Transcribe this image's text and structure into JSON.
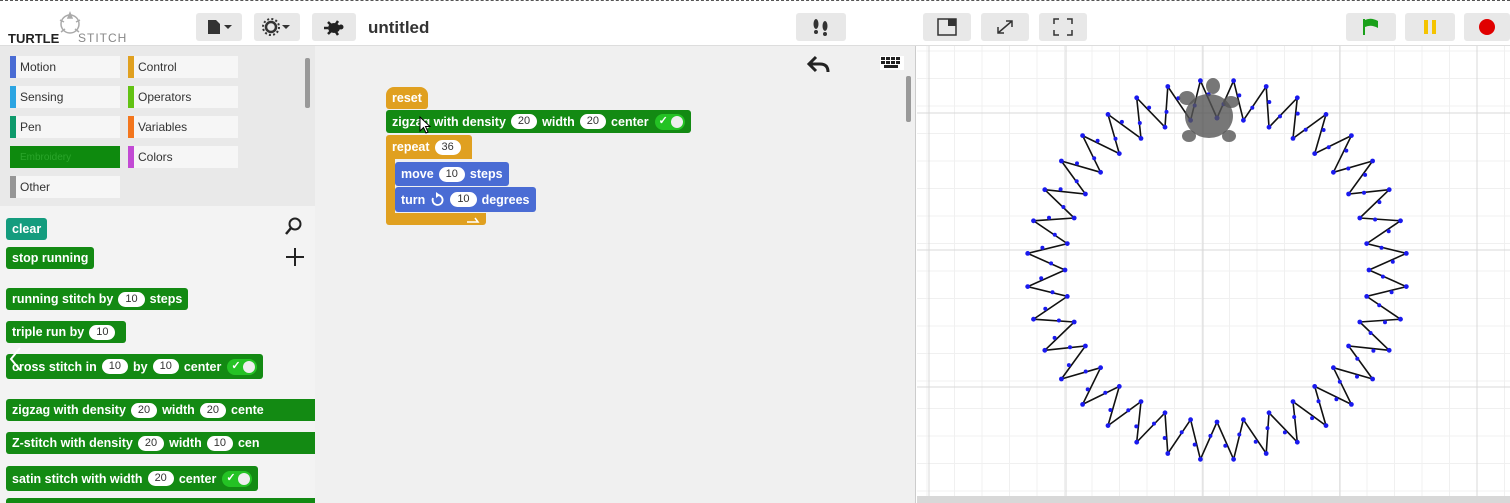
{
  "app": {
    "logo_left": "TURTLE",
    "logo_right": "STITCH",
    "project_name": "untitled"
  },
  "categories": [
    {
      "label": "Motion",
      "color": "#4a6cd4"
    },
    {
      "label": "Control",
      "color": "#e0a020"
    },
    {
      "label": "Sensing",
      "color": "#2ca5e2"
    },
    {
      "label": "Operators",
      "color": "#62c213"
    },
    {
      "label": "Pen",
      "color": "#0e9a6c"
    },
    {
      "label": "Variables",
      "color": "#f3761d"
    },
    {
      "label": "Embroidery",
      "color": "#0e8a0e"
    },
    {
      "label": "Colors",
      "color": "#c24ad4"
    },
    {
      "label": "Other",
      "color": "#969696"
    }
  ],
  "palette_blocks": {
    "clear": "clear",
    "stop": "stop running",
    "running": {
      "label": "running stitch by",
      "val": "10",
      "suffix": "steps"
    },
    "triple": {
      "label": "triple run by",
      "val": "10"
    },
    "cross": {
      "label": "cross stitch in",
      "val1": "10",
      "by": "by",
      "val2": "10",
      "center": "center"
    },
    "zigzag": {
      "label": "zigzag with density",
      "val1": "20",
      "width": "width",
      "val2": "20",
      "center": "cente"
    },
    "zstitch": {
      "label": "Z-stitch with density",
      "val1": "20",
      "width": "width",
      "val2": "10",
      "center": "cen"
    },
    "satin": {
      "label": "satin stitch with width",
      "val": "20",
      "center": "center"
    }
  },
  "script": {
    "reset": "reset",
    "zigzag": {
      "label": "zigzag with density",
      "val1": "20",
      "width": "width",
      "val2": "20",
      "center": "center"
    },
    "repeat": {
      "label": "repeat",
      "val": "36"
    },
    "move": {
      "label": "move",
      "val": "10",
      "suffix": "steps"
    },
    "turn": {
      "label": "turn",
      "val": "10",
      "suffix": "degrees"
    }
  },
  "colors": {
    "green_flag": "#1aa01a",
    "pause": "#f5c400",
    "stop": "#e00000",
    "stitch": "#111111",
    "needle": "#1a1aee"
  }
}
